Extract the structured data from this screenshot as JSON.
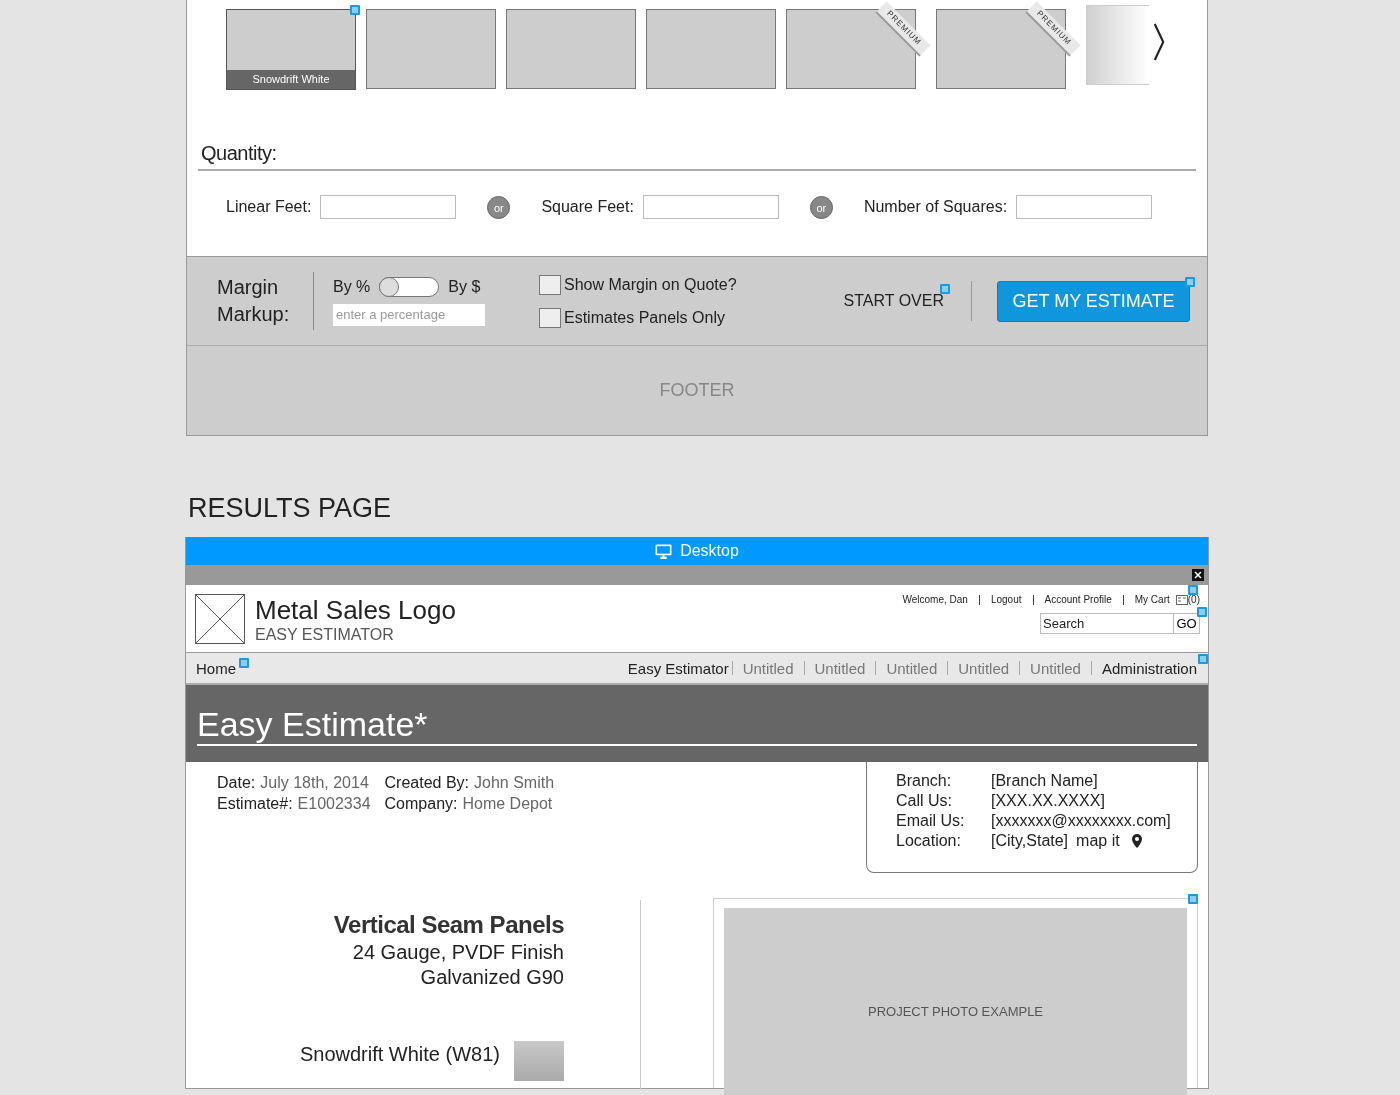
{
  "swatches": [
    {
      "label": "Snowdrift White",
      "selected": true,
      "premium": false
    },
    {
      "selected": false,
      "premium": false
    },
    {
      "selected": false,
      "premium": false
    },
    {
      "selected": false,
      "premium": false
    },
    {
      "selected": false,
      "premium": true,
      "ribbon": "PREMIUM"
    },
    {
      "selected": false,
      "premium": true,
      "ribbon": "PREMIUM"
    }
  ],
  "quantity": {
    "title": "Quantity:",
    "fields": [
      {
        "label": "Linear Feet:",
        "joiner": "or"
      },
      {
        "label": "Square Feet:",
        "joiner": "or"
      },
      {
        "label": "Number of Squares:"
      }
    ]
  },
  "margin": {
    "label": "Margin Markup:",
    "toggle_left": "By %",
    "toggle_right": "By $",
    "toggle_on": false,
    "placeholder": "enter a percentage",
    "checkboxes": [
      {
        "label": "Show Margin on Quote?",
        "checked": false
      },
      {
        "label": "Estimates Panels Only",
        "checked": false
      }
    ],
    "start_over": "START OVER",
    "estimate": "GET MY ESTIMATE"
  },
  "footer": "FOOTER",
  "section_title": "RESULTS PAGE",
  "device_bar": "Desktop",
  "header": {
    "logo": "Metal Sales Logo",
    "subtitle": "EASY ESTIMATOR",
    "user_links": [
      "Welcome, Dan",
      "Logout",
      "Account Profile",
      "My Cart"
    ],
    "cart_count": "(0)",
    "search_placeholder": "Search",
    "go": "GO"
  },
  "nav": {
    "home": "Home",
    "items": [
      {
        "label": "Easy Estimator",
        "muted": false
      },
      {
        "label": "Untitled",
        "muted": true
      },
      {
        "label": "Untitled",
        "muted": true
      },
      {
        "label": "Untitled",
        "muted": true
      },
      {
        "label": "Untitled",
        "muted": true
      },
      {
        "label": "Untitled",
        "muted": true
      },
      {
        "label": "Administration",
        "muted": false
      }
    ]
  },
  "banner_title": "Easy Estimate*",
  "estimate_info": [
    [
      {
        "label": "Date:",
        "value": "July 18th, 2014"
      },
      {
        "label": "Estimate#:",
        "value": "E1002334"
      }
    ],
    [
      {
        "label": "Created By:",
        "value": "John Smith"
      },
      {
        "label": "Company:",
        "value": "Home Depot"
      }
    ]
  ],
  "branch": [
    {
      "label": "Branch:",
      "value": "[Branch Name]"
    },
    {
      "label": "Call Us:",
      "value": "[XXX.XX.XXXX]"
    },
    {
      "label": "Email Us:",
      "value": "[xxxxxxx@xxxxxxxx.com]"
    },
    {
      "label": "Location:",
      "value": "[City,State]",
      "link": "map it"
    }
  ],
  "product": {
    "name": "Vertical Seam Panels",
    "lines": [
      "24 Gauge, PVDF Finish",
      "Galvanized G90"
    ],
    "color_name": "Snowdrift White (W81)"
  },
  "photo_label": "PROJECT PHOTO EXAMPLE"
}
